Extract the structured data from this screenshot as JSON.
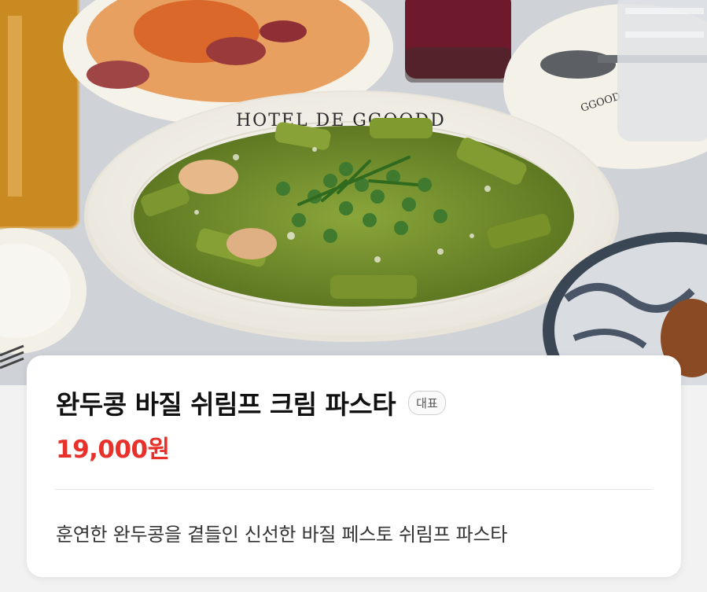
{
  "hero": {
    "plate_text": "HOTEL DE GGOODD",
    "side_plate_text": "GGOOD"
  },
  "menu": {
    "title": "완두콩 바질 쉬림프 크림 파스타",
    "badge": "대표",
    "price": "19,000원",
    "description": "훈연한 완두콩을 곁들인 신선한 바질 페스토 쉬림프 파스타"
  },
  "colors": {
    "price": "#e8312a",
    "pesto": "#6f8a2a",
    "pea": "#3f7a2e",
    "plate": "#f6f3ec"
  }
}
